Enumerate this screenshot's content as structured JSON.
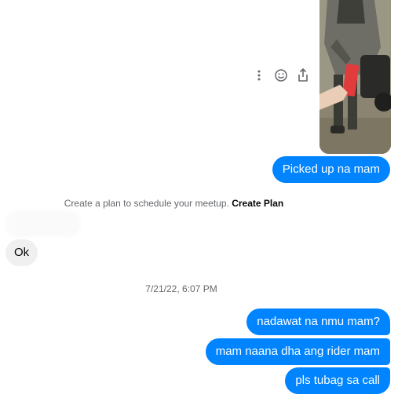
{
  "conversation": {
    "photo_alt": "Delivery photo: person handing a red envelope to a rider on a motorbike",
    "actions": [
      "more-options-icon",
      "react-icon",
      "share-icon"
    ],
    "messages_out_1": "Picked up na mam",
    "system_note_text": "Create a plan to schedule your meetup.",
    "system_note_link": "Create Plan",
    "incoming_1": "Ok",
    "timestamp": "7/21/22, 6:07 PM",
    "messages_out_2": "nadawat na nmu mam?",
    "messages_out_3": "mam naana dha ang rider mam",
    "messages_out_4": "pls tubag sa call"
  },
  "colors": {
    "outgoing_bubble": "#0084ff",
    "incoming_bubble": "#f0f0f0",
    "meta_text": "#65676b"
  }
}
